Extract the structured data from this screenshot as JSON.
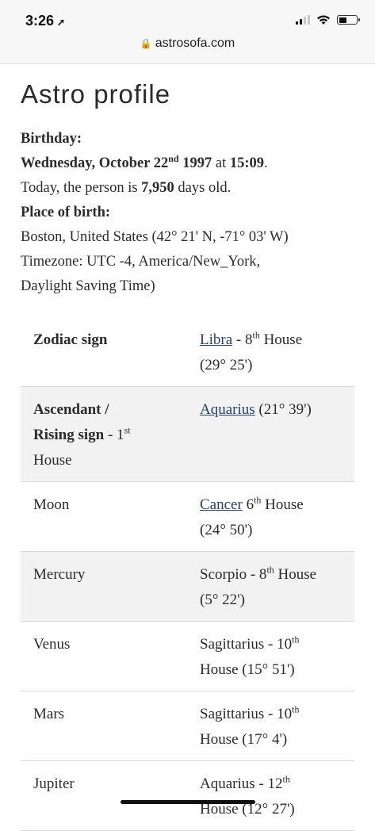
{
  "status_bar": {
    "time": "3:26"
  },
  "browser": {
    "url": "astrosofa.com"
  },
  "page": {
    "title": "Astro profile"
  },
  "birthday": {
    "label": "Birthday:",
    "weekday_date": "Wednesday, October 22",
    "day_suffix": "nd",
    "year": "1997",
    "at": "at",
    "time": "15:09",
    "period": ".",
    "age_prefix": "Today, the person is",
    "age_days": "7,950",
    "age_suffix": "days old."
  },
  "place": {
    "label": "Place of birth:",
    "location": "Boston, United States (42° 21' N, -71° 03' W)",
    "timezone_line1": "Timezone: UTC -4, America/New_York,",
    "timezone_line2": "Daylight Saving Time)"
  },
  "table": {
    "rows": [
      {
        "name": "Zodiac sign",
        "sign": "Libra",
        "detail_pre": " - 8",
        "sup": "th",
        "detail_post": " House",
        "degrees": "(29° 25')"
      },
      {
        "name": "Ascendant /",
        "name2": "Rising sign",
        "name_suffix": " - 1",
        "name_sup": "st",
        "name3": "House",
        "sign": "Aquarius",
        "detail": " (21° 39')"
      },
      {
        "name": "Moon",
        "sign": "Cancer",
        "detail_pre": " 6",
        "sup": "th",
        "detail_post": " House",
        "degrees": "(24° 50')"
      },
      {
        "name": "Mercury",
        "sign": "Scorpio",
        "detail_pre": " - 8",
        "sup": "th",
        "detail_post": " House",
        "degrees": "(5° 22')"
      },
      {
        "name": "Venus",
        "sign": "Sagittarius",
        "detail_pre": " - 10",
        "sup": "th",
        "degrees": "House (15° 51')"
      },
      {
        "name": "Mars",
        "sign": "Sagittarius",
        "detail_pre": " - 10",
        "sup": "th",
        "degrees": "House (17° 4')"
      },
      {
        "name": "Jupiter",
        "sign": "Aquarius",
        "detail_pre": " - 12",
        "sup": "th",
        "degrees": "House (12° 27')"
      }
    ]
  }
}
